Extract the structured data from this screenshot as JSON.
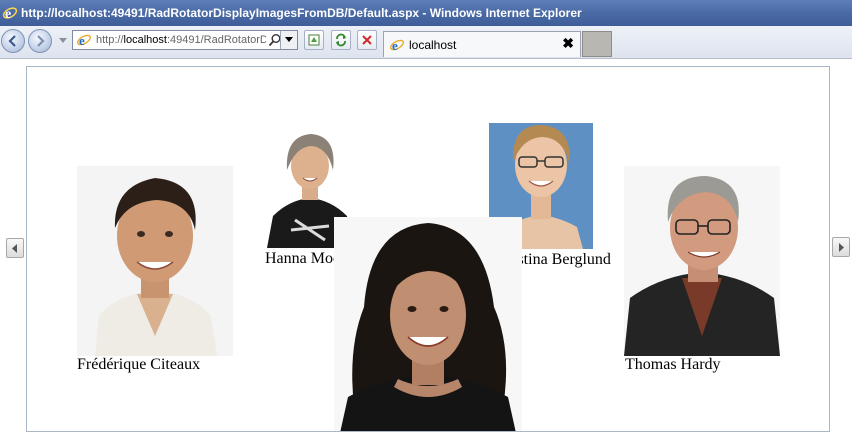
{
  "window": {
    "title": "http://localhost:49491/RadRotatorDisplayImagesFromDB/Default.aspx - Windows Internet Explorer"
  },
  "toolbar": {
    "address_prefix": "http://",
    "address_host": "localhost",
    "address_rest": ":49491/RadRotatorDisplayImagesFromDB/Default.aspx"
  },
  "tab": {
    "label": "localhost",
    "close": "✖"
  },
  "rotator": {
    "items": [
      {
        "name": "Frédérique Citeaux"
      },
      {
        "name": "Hanna Moos"
      },
      {
        "name": "Christina Berglund"
      },
      {
        "name": "Thomas Hardy"
      }
    ]
  },
  "colors": {
    "titlebar": "#4a6aa6",
    "rotator_border": "#a9b8c7"
  }
}
